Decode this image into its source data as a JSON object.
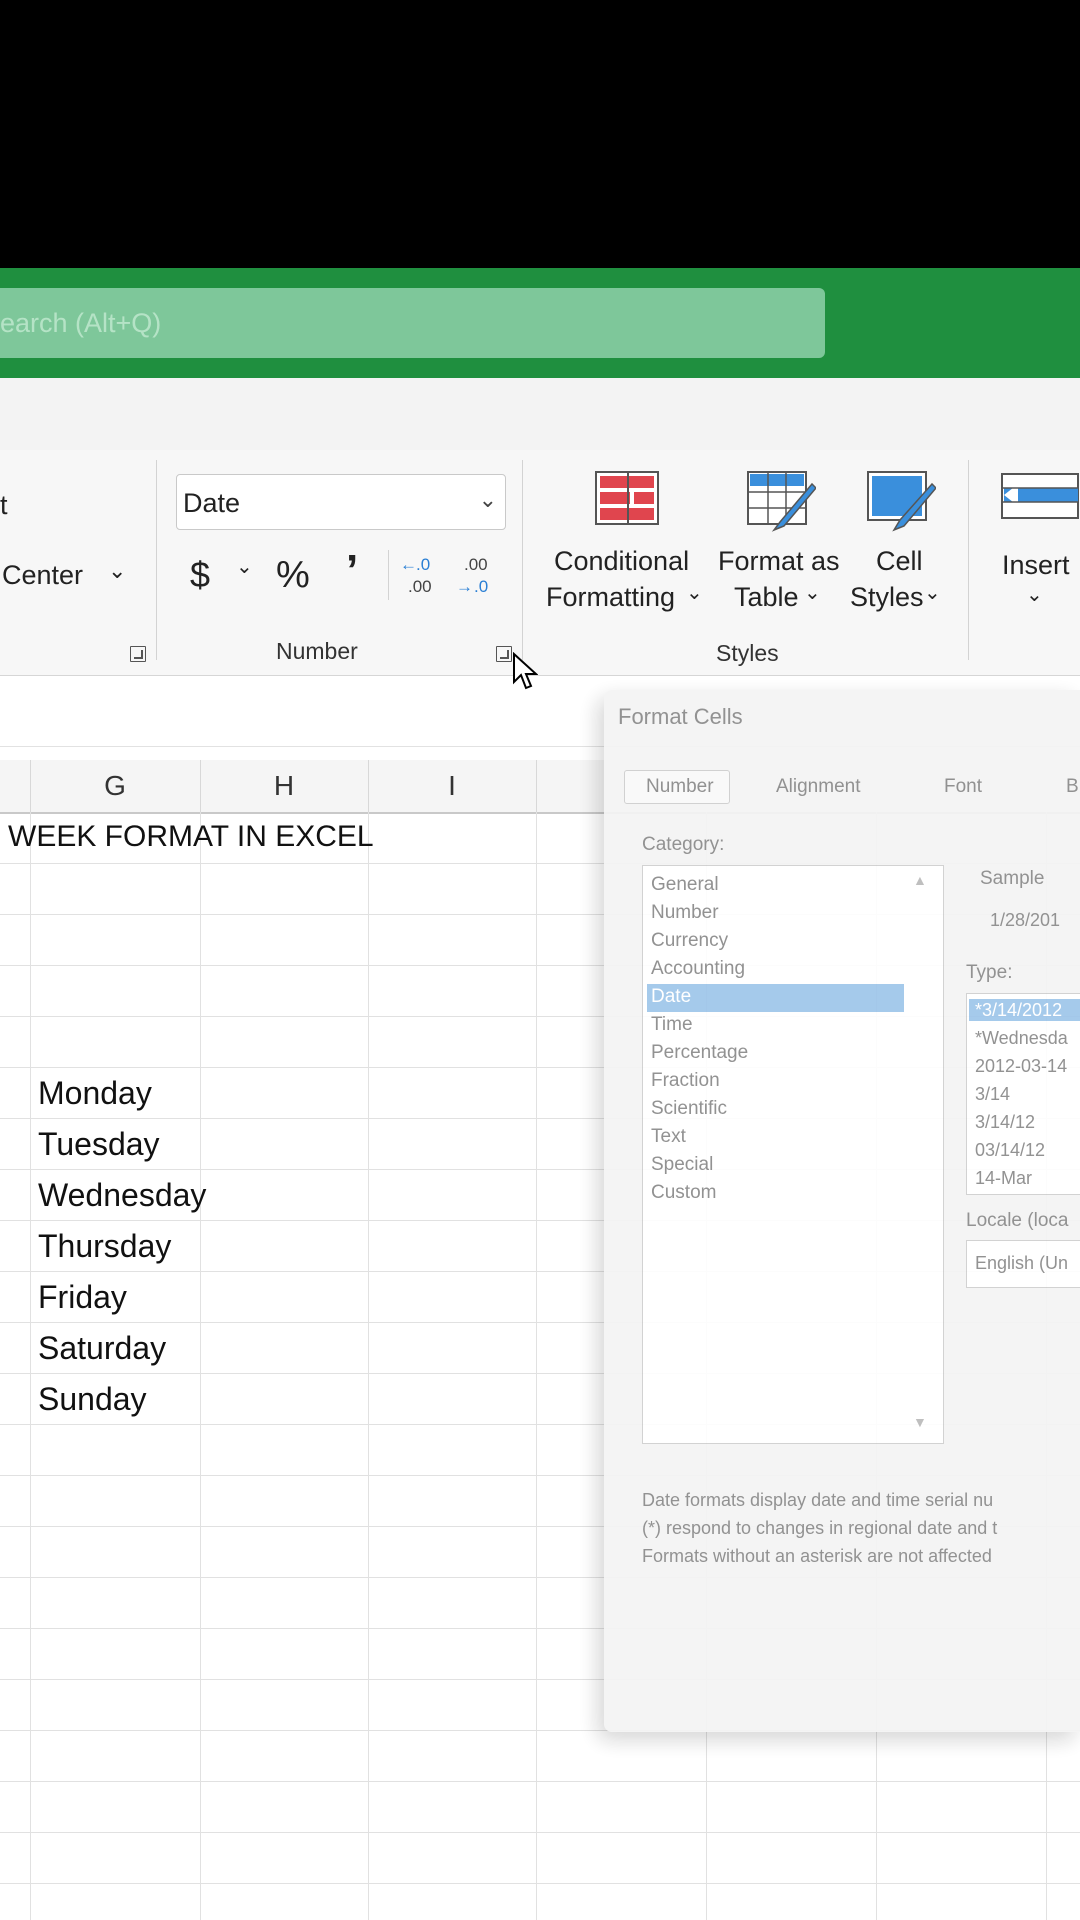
{
  "search": {
    "placeholder": "earch (Alt+Q)"
  },
  "ribbon": {
    "alignment_partial_t": "t",
    "merge_center_label": "Center",
    "number_format_value": "Date",
    "currency_symbol": "$",
    "percent_symbol": "%",
    "comma_symbol": "9",
    "increase_decimal": "←.0\n.00",
    "decrease_decimal": ".00\n→.0",
    "number_group_label": "Number",
    "conditional_formatting": [
      "Conditional",
      "Formatting"
    ],
    "format_as_table": [
      "Format as",
      "Table"
    ],
    "cell_styles": [
      "Cell",
      "Styles"
    ],
    "styles_group_label": "Styles",
    "insert_label": "Insert"
  },
  "sheet": {
    "columns": [
      "G",
      "H",
      "I"
    ],
    "title_cell": "WEEK FORMAT IN EXCEL",
    "days": [
      "Monday",
      "Tuesday",
      "Wednesday",
      "Thursday",
      "Friday",
      "Saturday",
      "Sunday"
    ]
  },
  "dialog": {
    "title": "Format Cells",
    "tabs": [
      "Number",
      "Alignment",
      "Font",
      "B"
    ],
    "tab_number_label": "Number",
    "tab_alignment_label": "Alignment",
    "tab_font_label": "Font",
    "tab_border_partial": "B",
    "category_label": "Category:",
    "categories": [
      "General",
      "Number",
      "Currency",
      "Accounting",
      "Date",
      "Time",
      "Percentage",
      "Fraction",
      "Scientific",
      "Text",
      "Special",
      "Custom"
    ],
    "selected_category": "Date",
    "sample_label": "Sample",
    "sample_value": "1/28/201",
    "type_label": "Type:",
    "types": [
      "*3/14/2012",
      "*Wednesda",
      "2012-03-14",
      "3/14",
      "3/14/12",
      "03/14/12",
      "14-Mar"
    ],
    "locale_label": "Locale (loca",
    "locale_value": "English (Un",
    "description": [
      "Date formats display date and time serial nu",
      "(*) respond to changes in regional date and t",
      "Formats without an asterisk are not affected"
    ]
  }
}
